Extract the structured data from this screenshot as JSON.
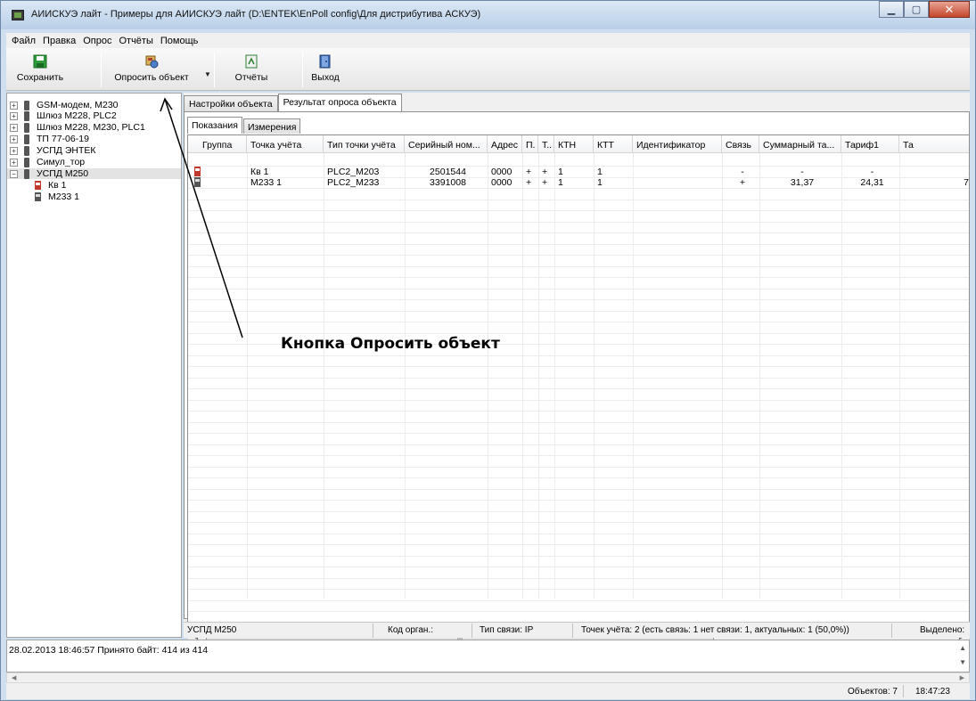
{
  "window": {
    "title": "АИИСКУЭ лайт - Примеры для АИИСКУЭ лайт (D:\\ENTEK\\EnPoll config\\Для дистрибутива АСКУЭ)"
  },
  "menu": [
    "Файл",
    "Правка",
    "Опрос",
    "Отчёты",
    "Помощь"
  ],
  "toolbar": {
    "save": "Сохранить",
    "poll": "Опросить объект",
    "reports": "Отчёты",
    "exit": "Выход"
  },
  "tree": {
    "items": [
      "GSM-модем, M230",
      "Шлюз M228, PLC2",
      "Шлюз M228, M230, PLC1",
      "ТП 77-06-19",
      "УСПД ЭНТЕК",
      "Симул_тор",
      "УСПД М250"
    ],
    "children": [
      "Кв 1",
      "М233 1"
    ]
  },
  "tabs": {
    "settings": "Настройки объекта",
    "result": "Результат опроса объекта",
    "readings": "Показания",
    "measurements": "Измерения"
  },
  "grid": {
    "columns": [
      "Группа",
      "Точка учёта",
      "Тип точки учёта",
      "Серийный ном...",
      "Адрес",
      "П.",
      "Т..",
      "КТН",
      "КТТ",
      "Идентификатор",
      "Связь",
      "Суммарный та...",
      "Тариф1",
      "Та"
    ],
    "rows": [
      [
        "",
        "Кв 1",
        "PLC2_M203",
        "2501544",
        "0000",
        "+",
        "+",
        "1",
        "1",
        "",
        "-",
        "-",
        "-",
        ""
      ],
      [
        "",
        "М233 1",
        "PLC2_M233",
        "3391008",
        "0000",
        "+",
        "+",
        "1",
        "1",
        "",
        "+",
        "31,37",
        "24,31",
        "7"
      ]
    ]
  },
  "status": {
    "object": "УСПД М250",
    "code": "Код орган.:",
    "link": "Тип связи: IP",
    "points": "Точек учёта: 2 (есть связь: 1  нет связи: 1, актуальных: 1 (50,0%))",
    "selected": "Выделено: "
  },
  "log": {
    "line": "28.02.2013 18:46:57  Принято байт: 414 из 414"
  },
  "bottom": {
    "objects": "Объектов: 7",
    "time": "18:47:23"
  },
  "annotation": {
    "text": "Кнопка Опросить объект"
  }
}
